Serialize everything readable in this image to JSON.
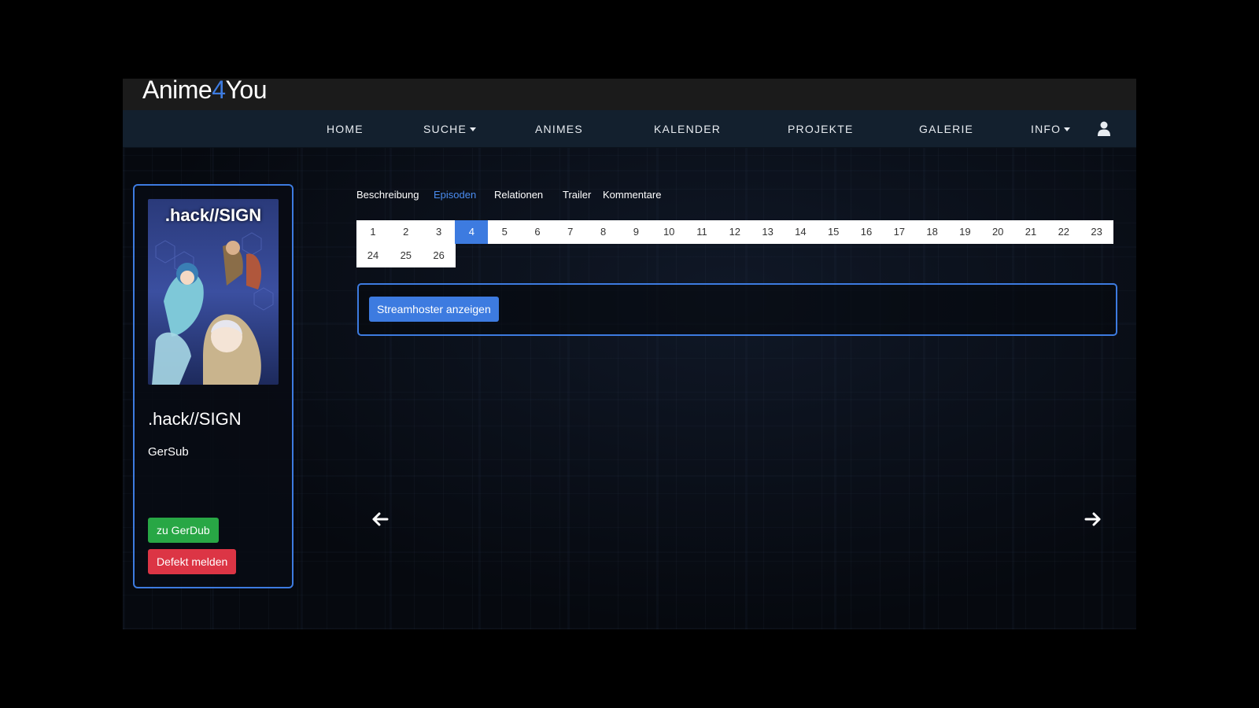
{
  "brand": {
    "name_part1": "Anime",
    "name_accent": "4",
    "name_part2": "You",
    "accent_color": "#3d7be0"
  },
  "nav": {
    "items": [
      {
        "label": "HOME",
        "dropdown": false
      },
      {
        "label": "SUCHE",
        "dropdown": true
      },
      {
        "label": "ANIMES",
        "dropdown": false
      },
      {
        "label": "KALENDER",
        "dropdown": false
      },
      {
        "label": "PROJEKTE",
        "dropdown": false
      },
      {
        "label": "GALERIE",
        "dropdown": false
      },
      {
        "label": "INFO",
        "dropdown": true
      }
    ],
    "user_icon": "user-icon"
  },
  "sidebar": {
    "cover_title": ".hack//SIGN",
    "title": ".hack//SIGN",
    "subtitle": "GerSub",
    "switch_button": "zu GerDub",
    "report_button": "Defekt melden"
  },
  "tabs": [
    {
      "label": "Beschreibung",
      "active": false
    },
    {
      "label": "Episoden",
      "active": true
    },
    {
      "label": "Relationen",
      "active": false
    },
    {
      "label": "Trailer",
      "active": false
    },
    {
      "label": "Kommentare",
      "active": false
    }
  ],
  "episodes": {
    "numbers": [
      "1",
      "2",
      "3",
      "4",
      "5",
      "6",
      "7",
      "8",
      "9",
      "10",
      "11",
      "12",
      "13",
      "14",
      "15",
      "16",
      "17",
      "18",
      "19",
      "20",
      "21",
      "22",
      "23",
      "24",
      "25",
      "26"
    ],
    "active": "4"
  },
  "stream": {
    "button_label": "Streamhoster anzeigen"
  },
  "arrows": {
    "prev": "arrow-left-icon",
    "next": "arrow-right-icon"
  },
  "colors": {
    "primary": "#3d7be0",
    "success": "#28a745",
    "danger": "#dc3545",
    "navbar": "#13202e"
  }
}
